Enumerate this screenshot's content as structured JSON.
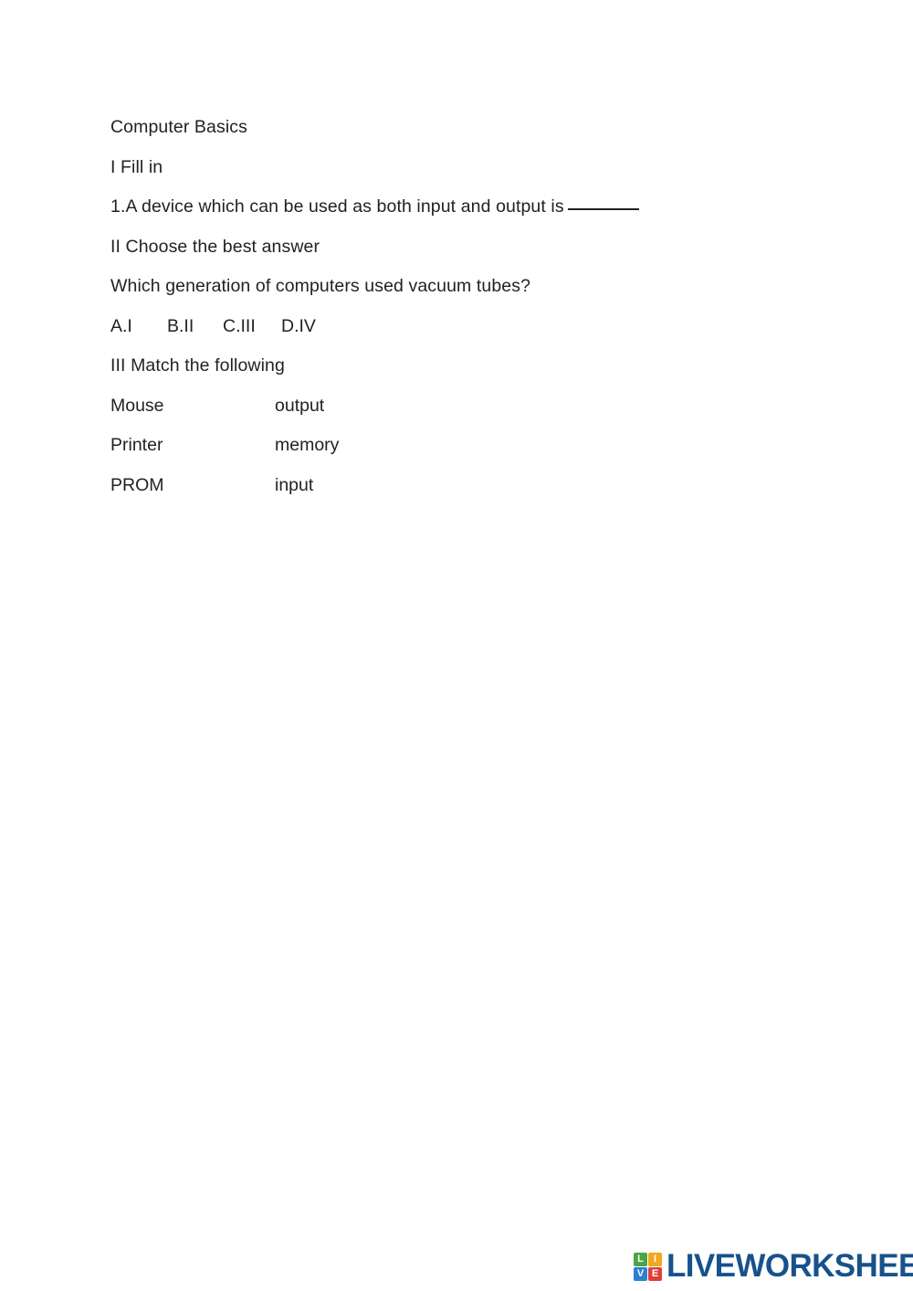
{
  "document": {
    "title": "Computer Basics",
    "sections": [
      {
        "id": "section-1",
        "heading": "I Fill in"
      },
      {
        "id": "section-2",
        "heading": "II Choose the best answer"
      },
      {
        "id": "section-3",
        "heading": "III Match the following"
      }
    ],
    "fill_in": {
      "question_number": "1.",
      "question_text": "1.A device which can be used as both input and output is",
      "blank_placeholder": "________"
    },
    "multiple_choice": {
      "question": "Which generation of computers used vacuum tubes?",
      "options": [
        {
          "label": "A.I",
          "letter": "A",
          "value": "I"
        },
        {
          "label": "B.II",
          "letter": "B",
          "value": "II"
        },
        {
          "label": "C.III",
          "letter": "C",
          "value": "III"
        },
        {
          "label": "D.IV",
          "letter": "D",
          "value": "IV"
        }
      ]
    },
    "matching": {
      "pairs": [
        {
          "left": "Mouse",
          "right": "output"
        },
        {
          "left": "Printer",
          "right": "memory"
        },
        {
          "left": "PROM",
          "right": "input"
        }
      ]
    }
  },
  "footer": {
    "brand": {
      "mark_letters": [
        "L",
        "I",
        "V",
        "E"
      ],
      "wordmark": "LIVEWORKSHEETS",
      "colors": {
        "wordmark": "#16528c",
        "cell_green": "#4aa544",
        "cell_orange": "#f0a81e",
        "cell_blue": "#2f7fd1",
        "cell_red": "#e0403a"
      }
    }
  },
  "page": {
    "background": "#ffffff",
    "text_color": "#222222"
  }
}
